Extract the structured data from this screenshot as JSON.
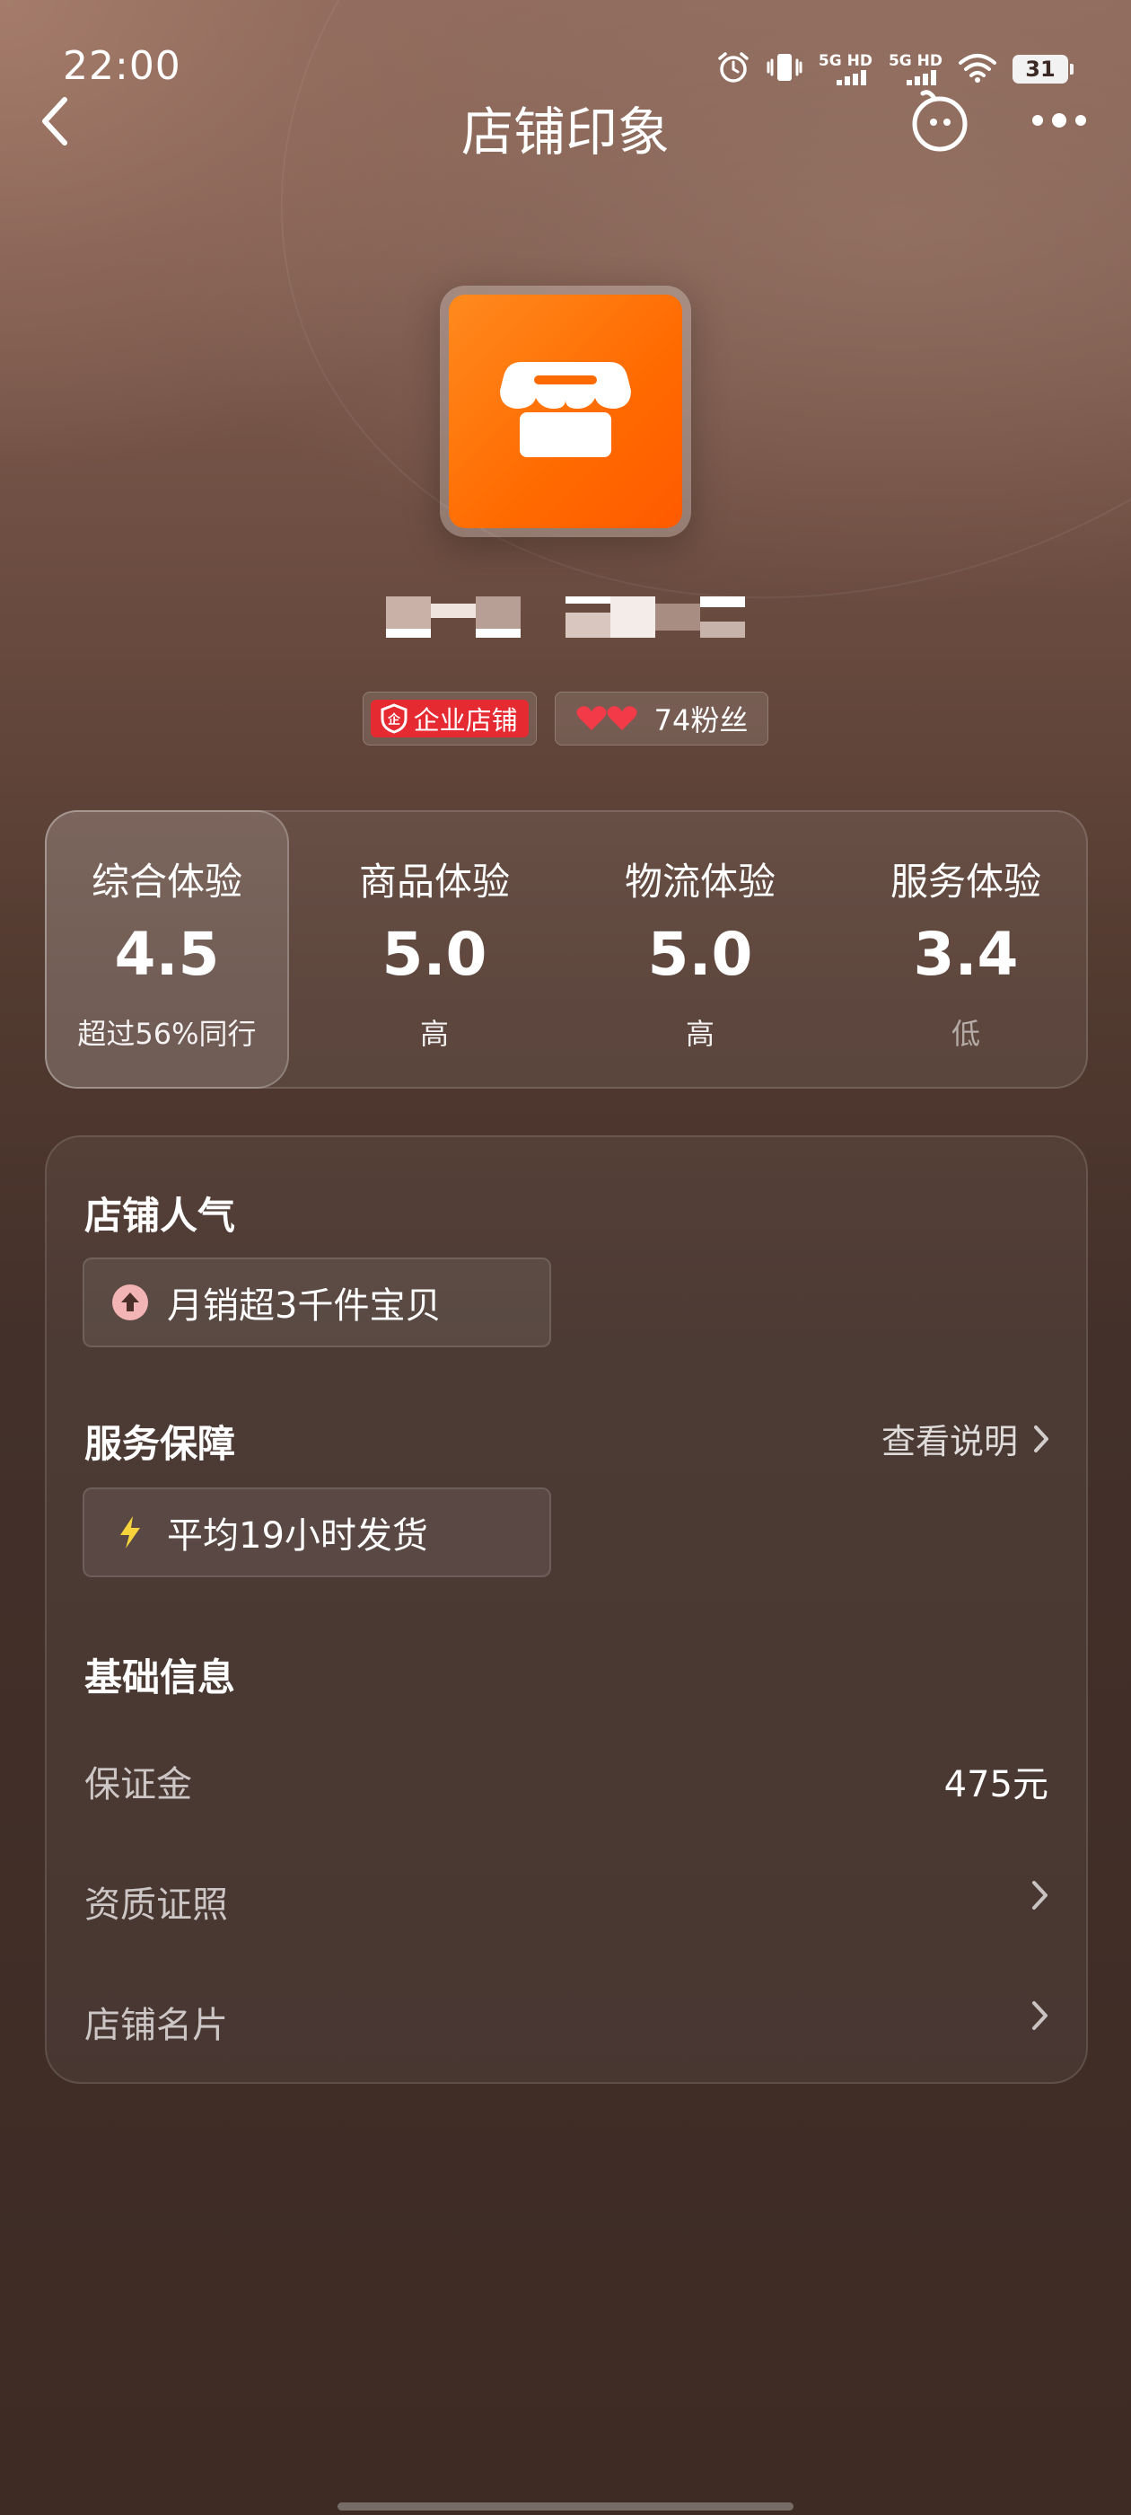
{
  "status_bar": {
    "time": "22:00",
    "signal1": "5G HD",
    "signal2": "5G HD",
    "battery": "31"
  },
  "nav": {
    "title": "店铺印象"
  },
  "shop": {
    "badge_enterprise": "企业店铺",
    "fans": "74粉丝"
  },
  "experience": [
    {
      "label": "综合体验",
      "score": "4.5",
      "sub": "超过56%同行"
    },
    {
      "label": "商品体验",
      "score": "5.0",
      "sub": "高"
    },
    {
      "label": "物流体验",
      "score": "5.0",
      "sub": "高"
    },
    {
      "label": "服务体验",
      "score": "3.4",
      "sub": "低"
    }
  ],
  "info": {
    "popularity_title": "店铺人气",
    "popularity_chip": "月销超3千件宝贝",
    "service_title": "服务保障",
    "service_link": "查看说明",
    "service_chip": "平均19小时发货",
    "basic_title": "基础信息",
    "deposit_label": "保证金",
    "deposit_value": "475元",
    "license_label": "资质证照",
    "card_label": "店铺名片"
  },
  "colors": {
    "brand_orange": "#ff6a00",
    "badge_red": "#e52a32",
    "background": "#3e2b22"
  }
}
